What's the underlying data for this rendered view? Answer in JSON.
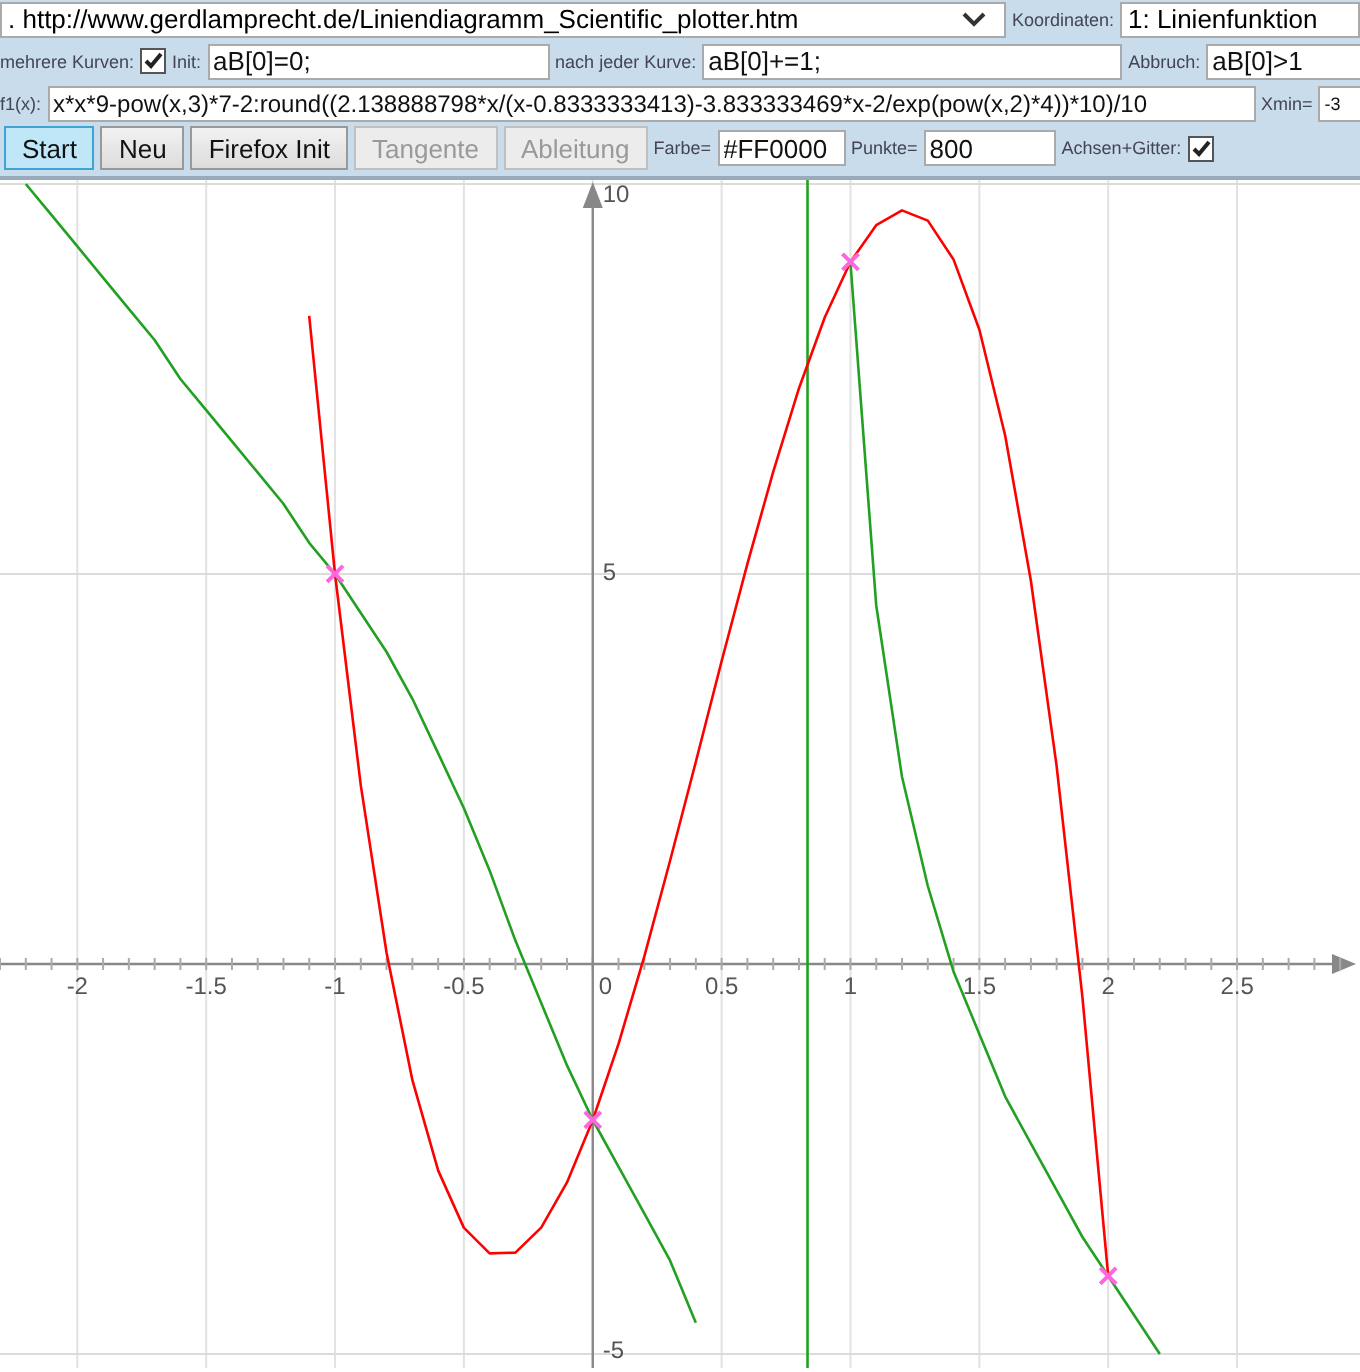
{
  "toolbar": {
    "url_select": {
      "value": ". http://www.gerdlamprecht.de/Liniendiagramm_Scientific_plotter.htm"
    },
    "coordinates": {
      "label": "Koordinaten:",
      "value": "1: Linienfunktion"
    },
    "multi_curves": {
      "label": "mehrere Kurven:",
      "checked": true
    },
    "init": {
      "label": "Init:",
      "value": "aB[0]=0;"
    },
    "after_curve": {
      "label": "nach jeder Kurve:",
      "value": "aB[0]+=1;"
    },
    "abort": {
      "label": "Abbruch:",
      "value": "aB[0]>1"
    },
    "formula": {
      "label": "f1(x):",
      "value": "x*x*9-pow(x,3)*7-2:round((2.138888798*x/(x-0.8333333413)-3.833333469*x-2/exp(pow(x,2)*4))*10)/10"
    },
    "xmin": {
      "label": "Xmin=",
      "value": "-3"
    },
    "buttons": [
      {
        "label": "Start",
        "selected": true,
        "disabled": false
      },
      {
        "label": "Neu",
        "selected": false,
        "disabled": false
      },
      {
        "label": "Firefox Init",
        "selected": false,
        "disabled": false
      },
      {
        "label": "Tangente",
        "selected": false,
        "disabled": true
      },
      {
        "label": "Ableitung",
        "selected": false,
        "disabled": true
      }
    ],
    "color": {
      "label": "Farbe=",
      "value": "#FF0000"
    },
    "points": {
      "label": "Punkte=",
      "value": "800"
    },
    "axes_grid": {
      "label": "Achsen+Gitter:",
      "checked": true
    }
  },
  "plot": {
    "chart_data": {
      "type": "line",
      "x": [
        -2.2,
        -2.1,
        -2.0,
        -1.9,
        -1.8,
        -1.7,
        -1.6,
        -1.5,
        -1.4,
        -1.3,
        -1.2,
        -1.1,
        -1.0,
        -0.9,
        -0.8,
        -0.7,
        -0.6,
        -0.5,
        -0.4,
        -0.3,
        -0.2,
        -0.1,
        0.0,
        0.1,
        0.2,
        0.3,
        0.4,
        0.5,
        0.6,
        0.7,
        0.8,
        0.9,
        1.0,
        1.1,
        1.2,
        1.3,
        1.4,
        1.5,
        1.6,
        1.7,
        1.8,
        1.9,
        2.0,
        2.1,
        2.2
      ],
      "series": [
        {
          "color": "#ff0000",
          "values": [
            null,
            null,
            null,
            null,
            null,
            null,
            null,
            null,
            null,
            null,
            null,
            8.31,
            5.0,
            2.29,
            0.14,
            -1.49,
            -2.65,
            -3.38,
            -3.71,
            -3.7,
            -3.38,
            -2.8,
            -2.0,
            -1.02,
            0.1,
            1.32,
            2.59,
            3.88,
            5.13,
            6.31,
            7.38,
            8.29,
            9.0,
            9.47,
            9.66,
            9.53,
            9.03,
            8.13,
            6.77,
            4.92,
            2.54,
            -0.42,
            -4.0,
            null,
            null
          ]
        },
        {
          "color": "#22a022",
          "values": [
            10.0,
            9.6,
            9.2,
            8.8,
            8.4,
            8.0,
            7.5,
            7.1,
            6.7,
            6.3,
            5.9,
            5.4,
            5.0,
            4.5,
            4.0,
            3.4,
            2.7,
            2.0,
            1.2,
            0.3,
            -0.5,
            -1.3,
            -2.0,
            -2.6,
            -3.2,
            -3.8,
            -4.6,
            null,
            null,
            null,
            null,
            null,
            9.0,
            4.6,
            2.4,
            1.0,
            -0.1,
            -0.9,
            -1.7,
            -2.3,
            -2.9,
            -3.5,
            -4.0,
            -4.5,
            -5.0
          ]
        },
        {
          "color": "#ff66dd",
          "marker": "x",
          "values": [
            null,
            null,
            null,
            null,
            null,
            null,
            null,
            null,
            null,
            null,
            null,
            null,
            5.0,
            null,
            null,
            null,
            null,
            null,
            null,
            null,
            null,
            null,
            -2.0,
            null,
            null,
            null,
            null,
            null,
            null,
            null,
            null,
            null,
            9.0,
            null,
            null,
            null,
            null,
            null,
            null,
            null,
            null,
            null,
            -4.0,
            null,
            null
          ]
        }
      ],
      "grid": true,
      "xlim": [
        -2.3,
        2.977
      ],
      "ylim": [
        -5.18,
        10.05
      ],
      "xticks": [
        -2,
        -1.5,
        -1,
        -0.5,
        0,
        0.5,
        1,
        1.5,
        2,
        2.5
      ],
      "yticks": [
        -5,
        5,
        10
      ],
      "ref_lines": [
        {
          "axis": "x",
          "value": 0.8333
        }
      ]
    }
  }
}
